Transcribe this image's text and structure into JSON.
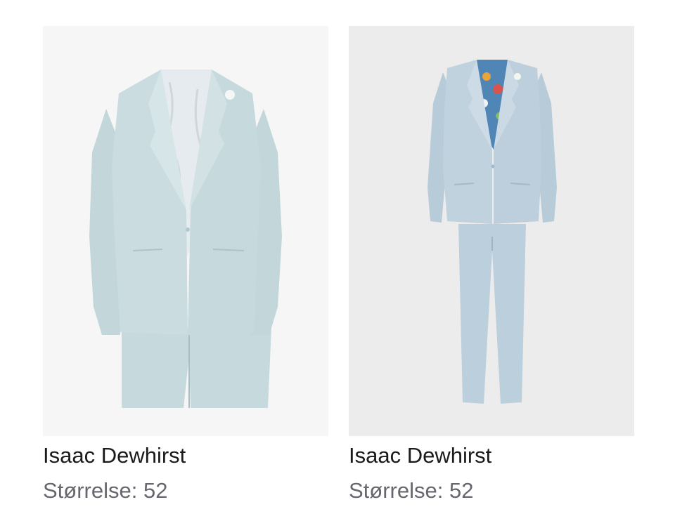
{
  "products": [
    {
      "brand": "Isaac Dewhirst",
      "size_text": "Størrelse: 52",
      "image_alt": "light blue slim suit on model",
      "colors": {
        "suit": "#c9dbde",
        "lining": "#e6ebef"
      }
    },
    {
      "brand": "Isaac Dewhirst",
      "size_text": "Størrelse: 52",
      "image_alt": "light blue suit with floral lining",
      "colors": {
        "suit": "#bfd0dd",
        "lining": "#4f86b5"
      }
    }
  ]
}
